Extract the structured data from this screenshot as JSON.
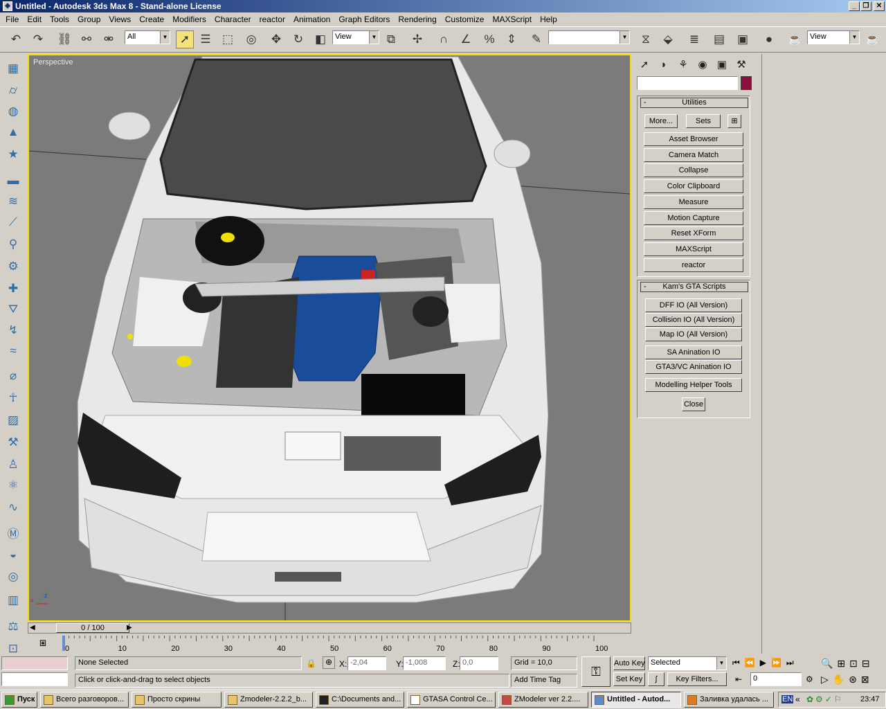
{
  "window": {
    "title": "Untitled - Autodesk 3ds Max 8  - Stand-alone License"
  },
  "menu": [
    "File",
    "Edit",
    "Tools",
    "Group",
    "Views",
    "Create",
    "Modifiers",
    "Character",
    "reactor",
    "Animation",
    "Graph Editors",
    "Rendering",
    "Customize",
    "MAXScript",
    "Help"
  ],
  "toolbar": {
    "selection_filter": "All",
    "ref_coord": "View",
    "named_sel": "",
    "view_right": "View"
  },
  "viewport": {
    "label": "Perspective"
  },
  "command_panel": {
    "name_field": "",
    "object_color": "#8c0e3c",
    "utilities": {
      "title": "Utilities",
      "more": "More...",
      "sets": "Sets",
      "buttons": [
        "Asset Browser",
        "Camera Match",
        "Collapse",
        "Color Clipboard",
        "Measure",
        "Motion Capture",
        "Reset XForm",
        "MAXScript",
        "reactor"
      ]
    },
    "kams": {
      "title": "Kam's GTA Scripts",
      "buttons": [
        "DFF IO (All Version)",
        "Collision IO (All Version)",
        "Map IO (All Version)",
        "SA Anination IO",
        "GTA3/VC Anination IO",
        "Modelling Helper Tools",
        "Close"
      ]
    }
  },
  "timeline": {
    "frame": "0 / 100",
    "ticks": [
      "0",
      "10",
      "20",
      "30",
      "40",
      "50",
      "60",
      "70",
      "80",
      "90",
      "100"
    ]
  },
  "status": {
    "selection": "None Selected",
    "prompt": "Click or click-and-drag to select objects",
    "x_label": "X:",
    "x": "-2,04",
    "y_label": "Y:",
    "y": "-1,008",
    "z_label": "Z:",
    "z": "0,0",
    "grid": "Grid = 10,0",
    "add_time_tag": "Add Time Tag",
    "auto_key": "Auto Key",
    "set_key": "Set Key",
    "key_mode": "Selected",
    "key_filters": "Key Filters...",
    "frame_value": "0"
  },
  "taskbar": {
    "start": "Пуск",
    "tasks": [
      "Всего разговоров...",
      "Просто скрины",
      "Zmodeler-2.2.2_b...",
      "C:\\Documents and...",
      "GTASA Control Ce...",
      "ZModeler ver 2.2....",
      "Untitled - Autod...",
      "Заливка удалась ..."
    ],
    "lang": "EN",
    "clock": "23:47"
  }
}
